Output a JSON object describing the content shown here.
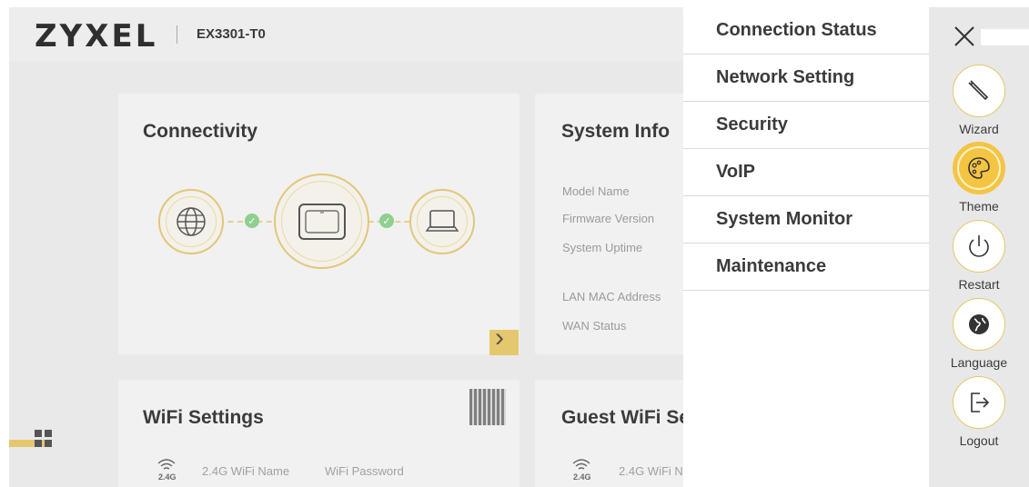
{
  "header": {
    "brand": "ZYXEL",
    "model": "EX3301-T0"
  },
  "dashboard": {
    "connectivity": {
      "title": "Connectivity"
    },
    "system_info": {
      "title": "System Info",
      "labels": [
        "Model Name",
        "Firmware Version",
        "System Uptime",
        "LAN MAC Address",
        "WAN Status"
      ]
    },
    "wifi_settings": {
      "title": "WiFi Settings",
      "band": "2.4G",
      "name_label": "2.4G WiFi Name",
      "password_label": "WiFi Password"
    },
    "guest_wifi": {
      "title": "Guest WiFi Se",
      "band": "2.4G",
      "name_label": "2.4G WiFi N"
    },
    "next_arrow": "›"
  },
  "menu": {
    "items": [
      "Connection Status",
      "Network Setting",
      "Security",
      "VoIP",
      "System Monitor",
      "Maintenance"
    ]
  },
  "rail": {
    "wizard": "Wizard",
    "theme": "Theme",
    "restart": "Restart",
    "language": "Language",
    "logout": "Logout"
  },
  "colors": {
    "accent": "#f5c443",
    "accent_border": "#e6c766",
    "panel_bg": "#ffffff",
    "rail_bg": "#e8e8e8"
  }
}
